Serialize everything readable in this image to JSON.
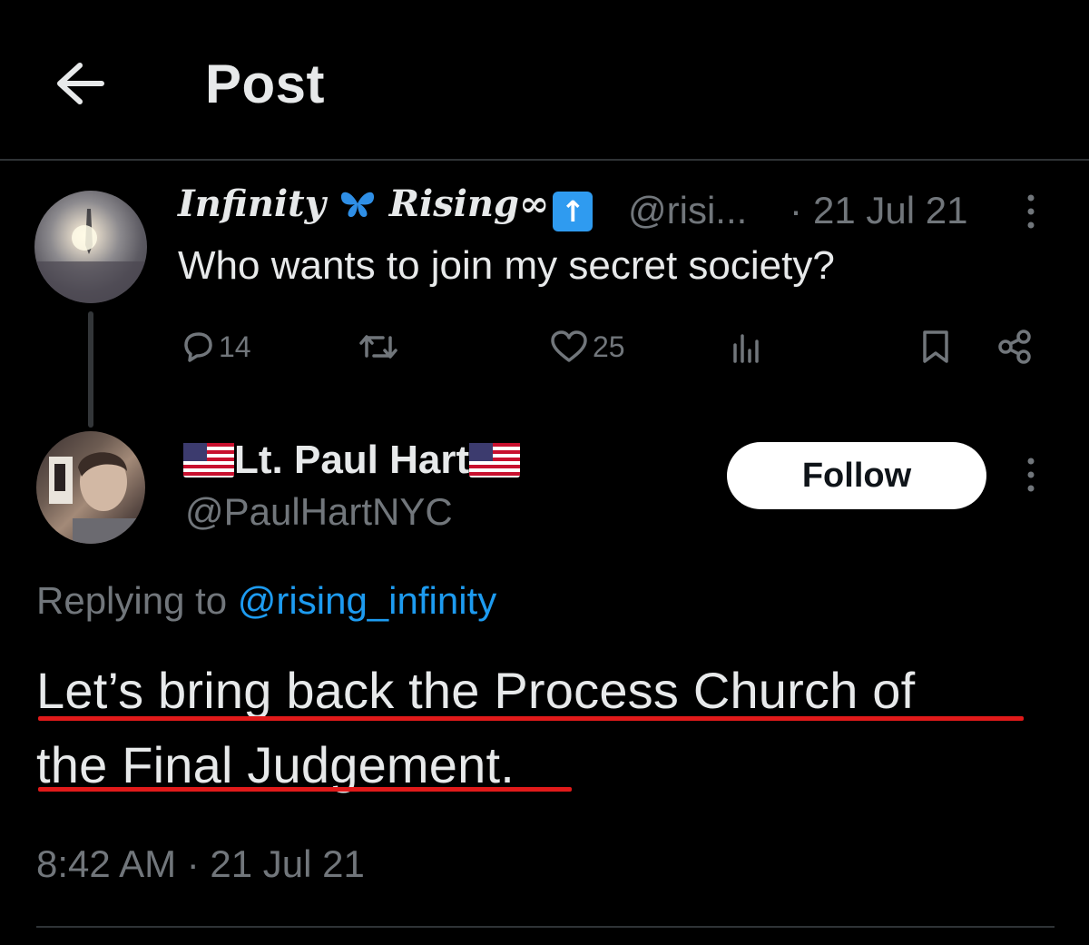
{
  "header": {
    "title": "Post",
    "back_icon": "arrow-left-icon"
  },
  "tweet1": {
    "display_name": "Infinity",
    "display_name_2": "Rising∞",
    "butterfly_icon": "butterfly-icon",
    "up_arrow_icon": "up-arrow-emoji-icon",
    "handle": "@risi...",
    "separator": "·",
    "date": "21 Jul 21",
    "text": "Who wants to join my secret society?",
    "replies": "14",
    "likes": "25"
  },
  "tweet2": {
    "display_name": "Lt. Paul Hart",
    "handle": "@PaulHartNYC",
    "follow_label": "Follow",
    "replying_prefix": "Replying to",
    "replying_mention": "@rising_infinity",
    "body_line_1": "Let’s bring back the Process Church of",
    "body_line_2": "the Final Judgement.",
    "timestamp": "8:42 AM · 21 Jul 21"
  },
  "colors": {
    "background": "#000000",
    "text": "#e7e9ea",
    "muted": "#71767b",
    "link": "#1d9bf0",
    "underline_annotation": "#e11a1a",
    "divider": "#2f3336"
  }
}
